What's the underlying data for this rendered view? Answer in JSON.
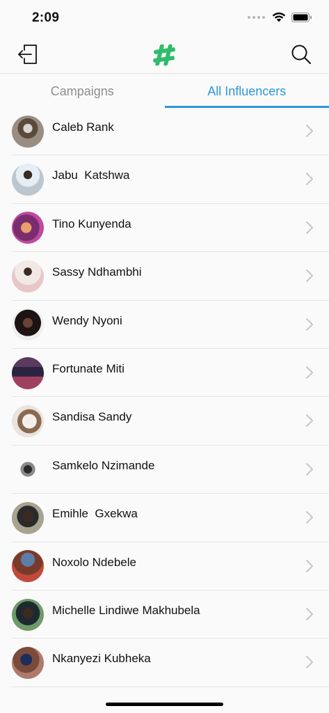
{
  "status": {
    "time": "2:09"
  },
  "nav": {
    "logout_icon": "logout-icon",
    "logo_icon": "hashtag-logo",
    "search_icon": "search-icon"
  },
  "tabs": [
    {
      "label": "Campaigns",
      "active": false
    },
    {
      "label": "All Influencers",
      "active": true
    }
  ],
  "colors": {
    "accent": "#2c98d8",
    "logo_green": "#2ebd6b",
    "inactive_tab": "#8e8e93"
  },
  "influencers": [
    {
      "name": "Caleb Rank"
    },
    {
      "name": "Jabu  Katshwa"
    },
    {
      "name": "Tino Kunyenda"
    },
    {
      "name": "Sassy Ndhambhi"
    },
    {
      "name": "Wendy Nyoni"
    },
    {
      "name": "Fortunate Miti"
    },
    {
      "name": "Sandisa Sandy"
    },
    {
      "name": "Samkelo Nzimande"
    },
    {
      "name": "Emihle  Gxekwa"
    },
    {
      "name": "Noxolo Ndebele"
    },
    {
      "name": "Michelle Lindiwe Makhubela"
    },
    {
      "name": "Nkanyezi Kubheka"
    }
  ]
}
